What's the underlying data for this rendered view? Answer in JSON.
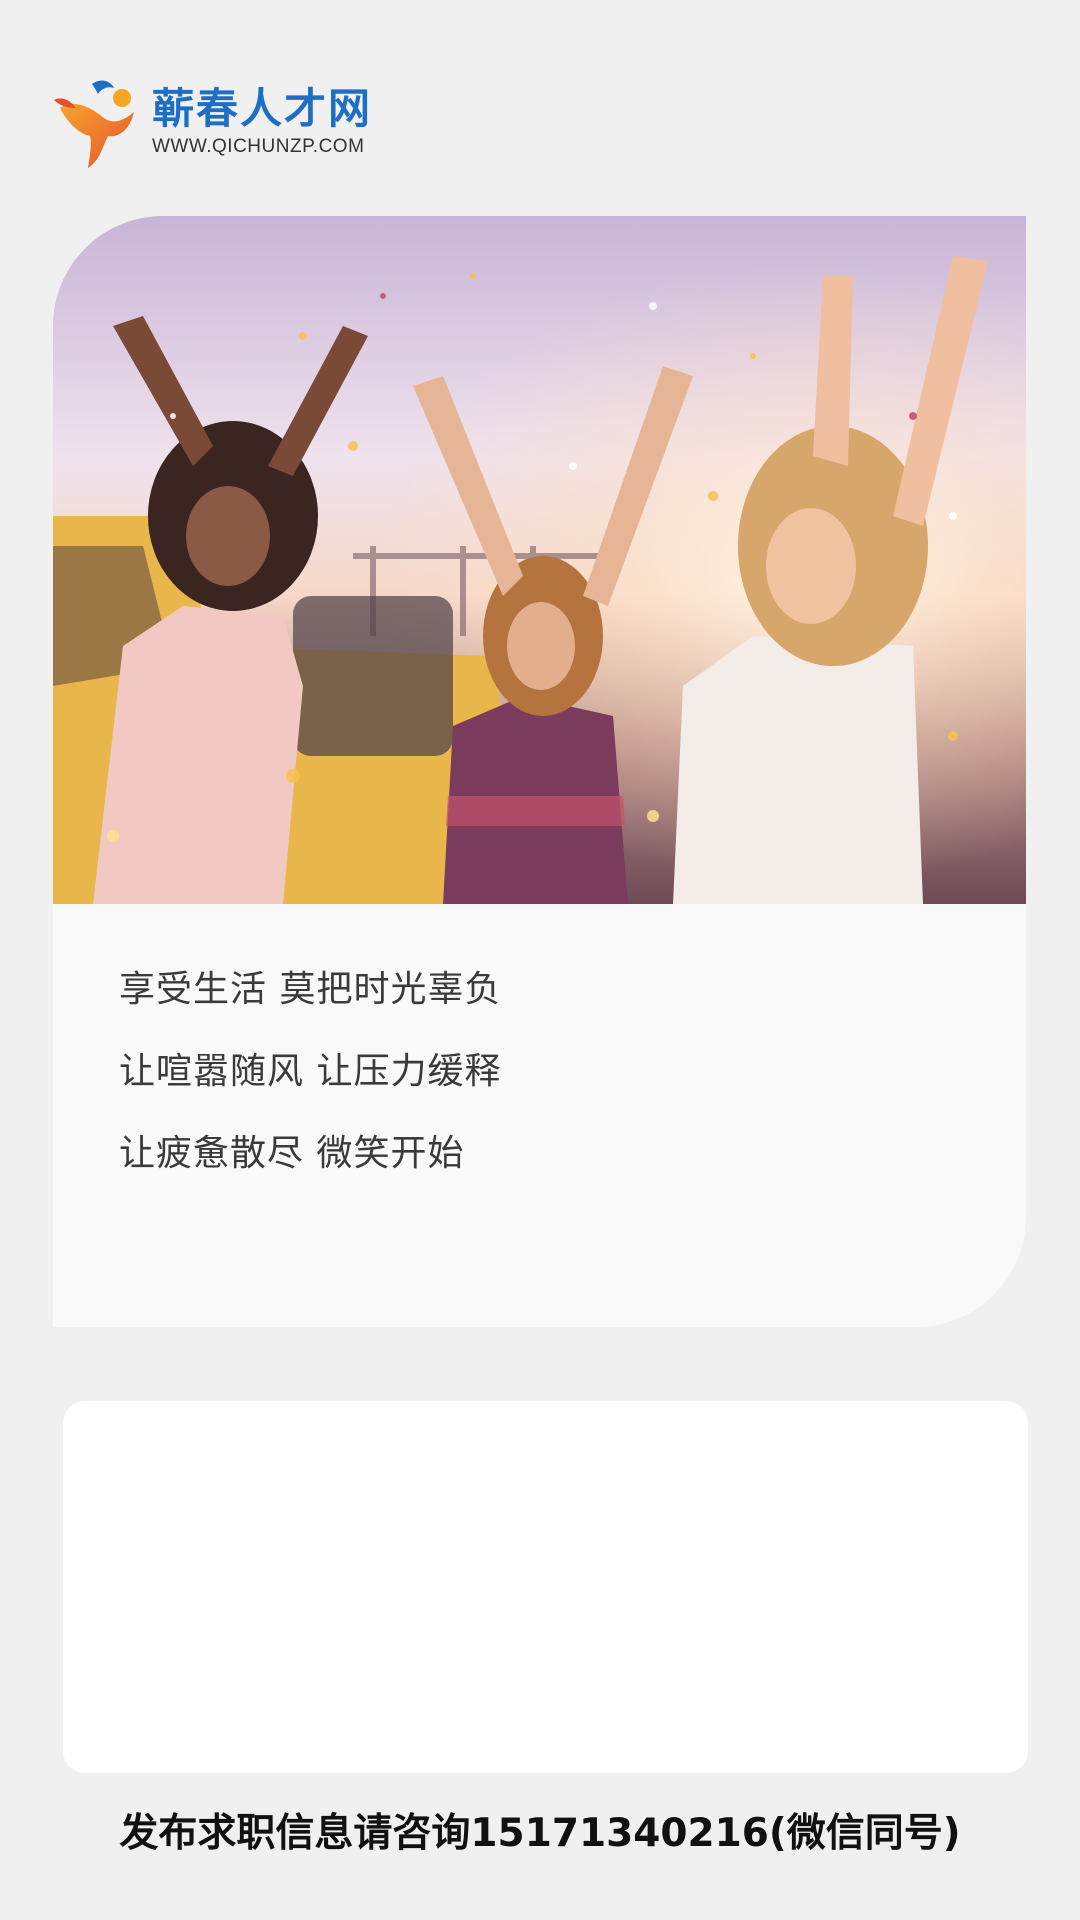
{
  "logo": {
    "name": "蕲春人才网",
    "url": "WWW.QICHUNZP.COM",
    "icon": "running-person-logo-icon",
    "colors": {
      "brand_blue": "#1e6fc4",
      "orange": "#f0861e",
      "red": "#d8402a"
    }
  },
  "hero": {
    "photo": "celebrating-friends-photo",
    "lines": [
      "享受生活 莫把时光辜负",
      "让喧嚣随风 让压力缓释",
      "让疲惫散尽 微笑开始"
    ]
  },
  "footer": {
    "text": "发布求职信息请咨询15171340216(微信同号)"
  }
}
